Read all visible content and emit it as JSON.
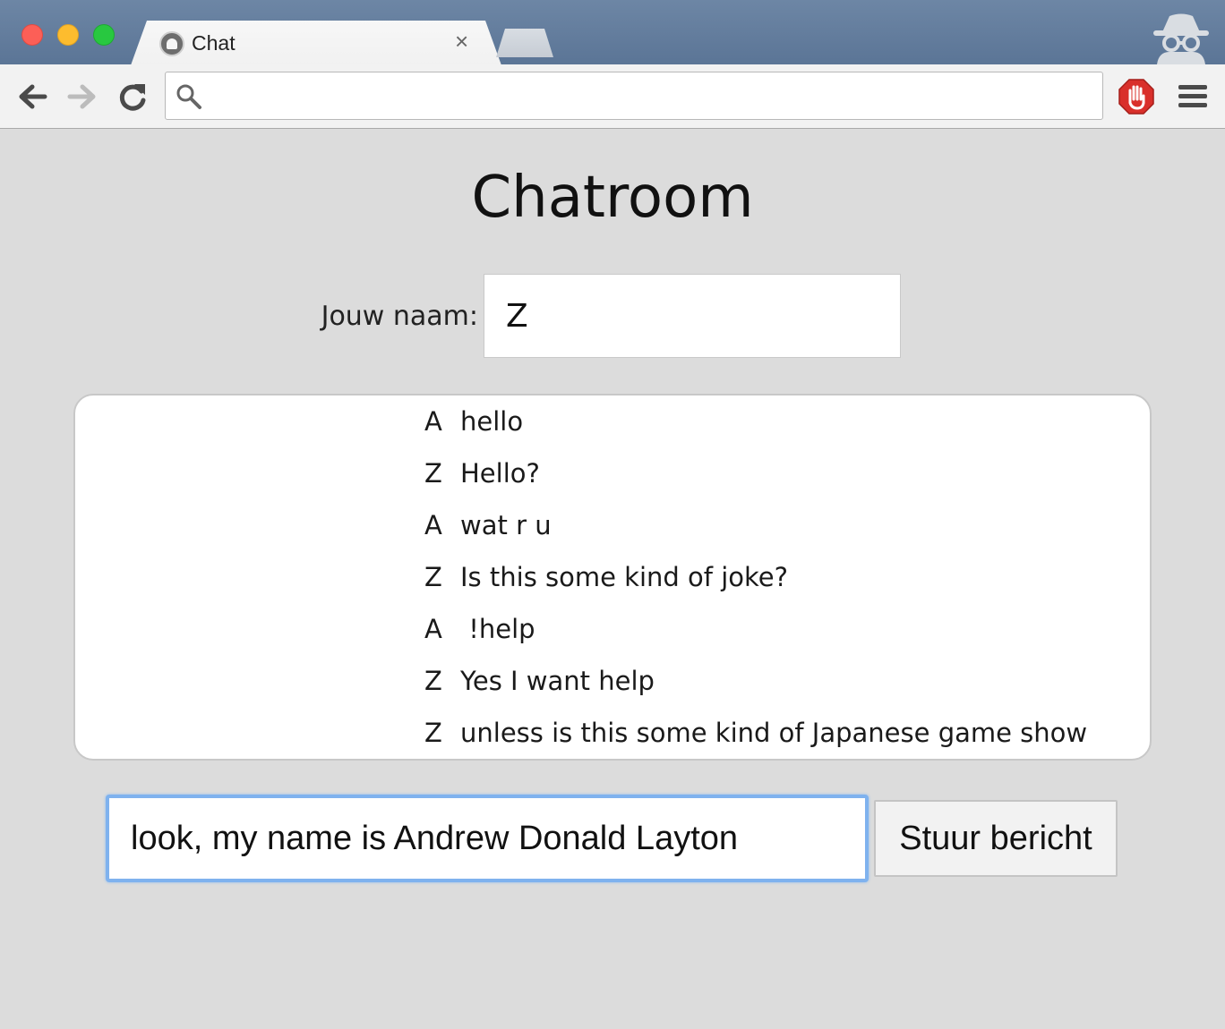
{
  "browser": {
    "tab_title": "Chat",
    "tab_close": "×",
    "url": "",
    "icons": {
      "back": "back-arrow-icon",
      "forward": "forward-arrow-icon",
      "reload": "reload-icon",
      "search": "search-icon",
      "adblock": "adblock-hand-icon",
      "menu": "hamburger-menu-icon",
      "incognito": "incognito-icon"
    }
  },
  "page": {
    "title": "Chatroom",
    "name_label": "Jouw naam:",
    "name_value": "Z"
  },
  "messages": [
    {
      "author": "A",
      "text": "hello"
    },
    {
      "author": "Z",
      "text": "Hello?"
    },
    {
      "author": "A",
      "text": "wat r u"
    },
    {
      "author": "Z",
      "text": "Is this some kind of joke?"
    },
    {
      "author": "A",
      "text": " !help"
    },
    {
      "author": "Z",
      "text": "Yes I want help"
    },
    {
      "author": "Z",
      "text": "unless is this some kind of Japanese game show"
    }
  ],
  "composer": {
    "value": "look, my name is Andrew Donald Layton",
    "send_label": "Stuur bericht"
  },
  "colors": {
    "focus_ring": "#7fb2ee",
    "titlebar": "#5b7596",
    "page_background": "#dcdcdc"
  }
}
